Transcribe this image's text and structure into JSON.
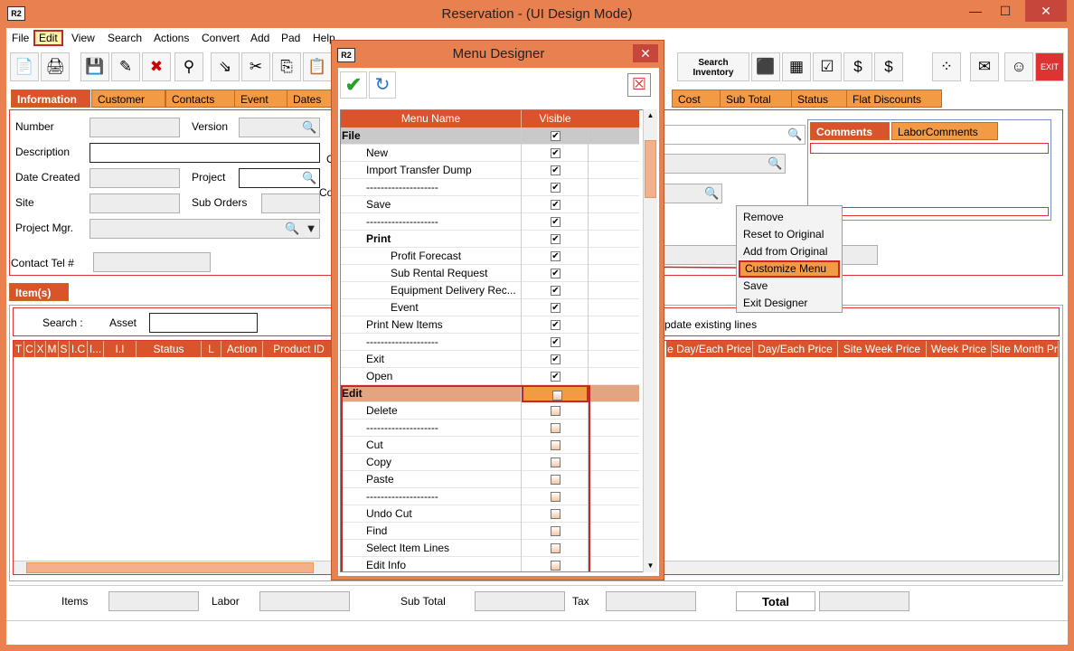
{
  "window": {
    "title": "Reservation - (UI Design Mode)",
    "app_icon": "R2",
    "minimize": "—",
    "maximize": "☐",
    "close": "✕"
  },
  "menubar": [
    "File",
    "Edit",
    "View",
    "Search",
    "Actions",
    "Convert",
    "Add",
    "Pad",
    "Help"
  ],
  "toolbar": {
    "search_inventory": "Search Inventory",
    "exit": "EXIT"
  },
  "tabs": [
    "Information",
    "Customer",
    "Contacts",
    "Event",
    "Dates",
    "Cost",
    "Sub Total",
    "Status",
    "Flat Discounts"
  ],
  "form": {
    "number": "Number",
    "version": "Version",
    "description": "Description",
    "date_created": "Date Created",
    "project": "Project",
    "site": "Site",
    "sub_orders": "Sub Orders",
    "project_mgr": "Project Mgr.",
    "contact_tel": "Contact Tel #",
    "c1": "C",
    "c2": "C",
    "co": "Co"
  },
  "comment_tabs": [
    "Comments",
    "LaborComments"
  ],
  "items_tab": "Item(s)",
  "items": {
    "search_label": "Search :",
    "asset_label": "Asset",
    "update_text": "pdate existing lines",
    "columns": [
      "T",
      "C",
      "X",
      "M",
      "S",
      "I.C",
      "I...",
      "I.I",
      "Status",
      "L",
      "Action",
      "Product ID"
    ],
    "columns_right": [
      "e Day/Each Price",
      "Day/Each Price",
      "Site Week Price",
      "Week Price",
      "Site Month Pr"
    ]
  },
  "footer": {
    "items": "Items",
    "labor": "Labor",
    "sub_total": "Sub Total",
    "tax": "Tax",
    "total": "Total"
  },
  "dialog": {
    "title": "Menu Designer",
    "close": "✕",
    "col_name": "Menu Name",
    "col_visible": "Visible",
    "rows": [
      {
        "name": "File",
        "level": 0,
        "visible": true,
        "header": true
      },
      {
        "name": "New",
        "level": 1,
        "visible": true
      },
      {
        "name": "Import Transfer Dump",
        "level": 1,
        "visible": true
      },
      {
        "name": "--------------------",
        "level": 1,
        "visible": true
      },
      {
        "name": "Save",
        "level": 1,
        "visible": true
      },
      {
        "name": "--------------------",
        "level": 1,
        "visible": true
      },
      {
        "name": "Print",
        "level": 1,
        "visible": true,
        "bold": true
      },
      {
        "name": "Profit Forecast",
        "level": 2,
        "visible": true
      },
      {
        "name": "Sub Rental Request",
        "level": 2,
        "visible": true
      },
      {
        "name": "Equipment Delivery Rec...",
        "level": 2,
        "visible": true
      },
      {
        "name": "Event",
        "level": 2,
        "visible": true
      },
      {
        "name": "Print New Items",
        "level": 1,
        "visible": true
      },
      {
        "name": "--------------------",
        "level": 1,
        "visible": true
      },
      {
        "name": "Exit",
        "level": 1,
        "visible": true
      },
      {
        "name": "Open",
        "level": 1,
        "visible": true
      },
      {
        "name": "Edit",
        "level": 0,
        "visible": false,
        "header": true,
        "selected": true
      },
      {
        "name": "Delete",
        "level": 1,
        "visible": false
      },
      {
        "name": "--------------------",
        "level": 1,
        "visible": false
      },
      {
        "name": "Cut",
        "level": 1,
        "visible": false
      },
      {
        "name": "Copy",
        "level": 1,
        "visible": false
      },
      {
        "name": "Paste",
        "level": 1,
        "visible": false
      },
      {
        "name": "--------------------",
        "level": 1,
        "visible": false
      },
      {
        "name": "Undo Cut",
        "level": 1,
        "visible": false
      },
      {
        "name": "Find",
        "level": 1,
        "visible": false
      },
      {
        "name": "Select Item Lines",
        "level": 1,
        "visible": false
      },
      {
        "name": "Edit Info",
        "level": 1,
        "visible": false
      }
    ]
  },
  "context_menu": [
    "Remove",
    "Reset to Original",
    "Add from Original",
    "Customize Menu",
    "Save",
    "Exit Designer"
  ],
  "colors": {
    "accent": "#e8804f",
    "tab": "#f39a45",
    "header": "#d9542a",
    "highlight": "#c62828"
  }
}
